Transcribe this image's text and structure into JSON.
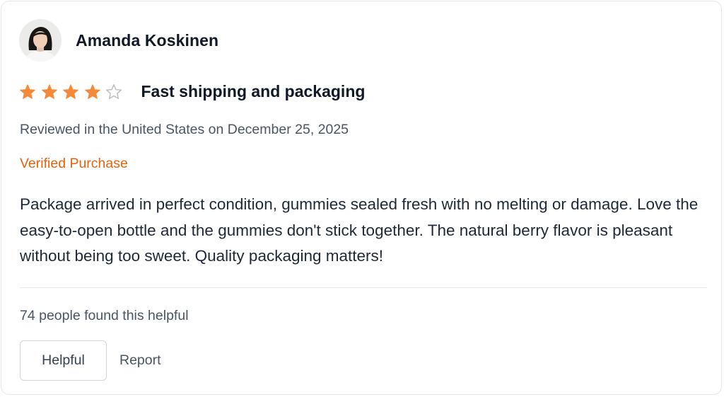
{
  "review": {
    "author": "Amanda Koskinen",
    "rating": 4,
    "rating_max": 5,
    "title": "Fast shipping and packaging",
    "meta": "Reviewed in the United States on December 25, 2025",
    "verified_label": "Verified Purchase",
    "body": "Package arrived in perfect condition, gummies sealed fresh with no melting or damage. Love the easy-to-open bottle and the gummies don't stick together. The natural berry flavor is pleasant without being too sweet. Quality packaging matters!",
    "helpful_count_text": "74 people found this helpful"
  },
  "actions": {
    "helpful_label": "Helpful",
    "report_label": "Report"
  },
  "colors": {
    "star_filled": "#f5893a",
    "star_empty_stroke": "#b8bcc4",
    "verified": "#e8610c"
  },
  "icons": {
    "avatar": "user-avatar-photo",
    "star": "star-icon"
  }
}
